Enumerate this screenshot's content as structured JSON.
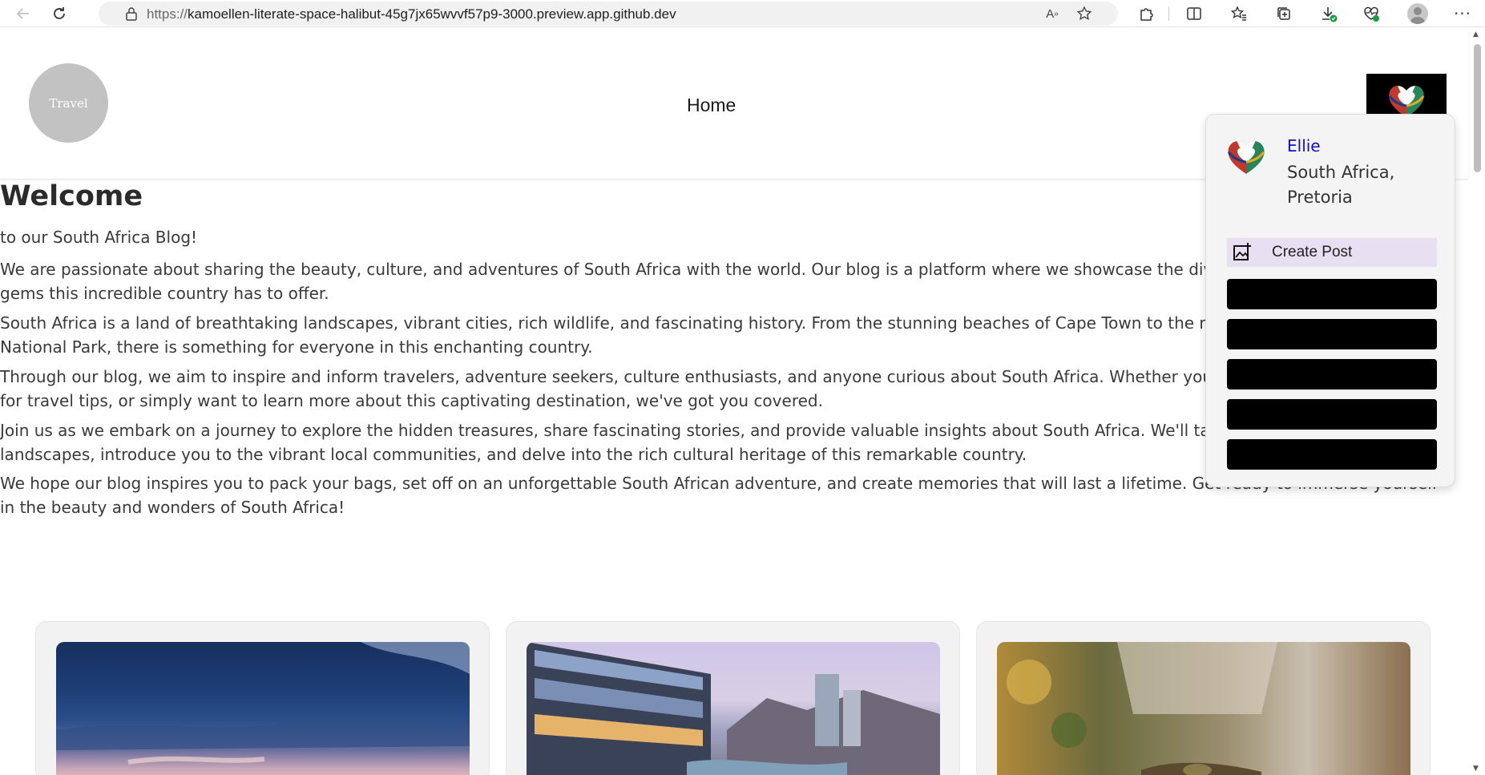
{
  "browser": {
    "url_scheme": "https://",
    "url_host": "kamoellen-literate-space-halibut-45g7jx65wvvf57p9-3000.preview.app.github.dev",
    "icons": [
      "back-icon",
      "refresh-icon",
      "lock-icon",
      "read-aloud-icon",
      "favorite-icon",
      "extensions-icon",
      "split-screen-icon",
      "favorites-icon",
      "collections-icon",
      "downloads-icon",
      "performance-icon",
      "profile-icon",
      "more-icon"
    ]
  },
  "header": {
    "logo_text": "Travel",
    "nav_home": "Home"
  },
  "main": {
    "title": "Welcome",
    "paragraphs": [
      "to our South Africa Blog!",
      "We are passionate about sharing the beauty, culture, and adventures of South Africa with the world. Our blog is a platform where we showcase the diverse experiences and hidden gems this incredible country has to offer.",
      "South Africa is a land of breathtaking landscapes, vibrant cities, rich wildlife, and fascinating history. From the stunning beaches of Cape Town to the majestic wildlife of Kruger National Park, there is something for everyone in this enchanting country.",
      "Through our blog, we aim to inspire and inform travelers, adventure seekers, culture enthusiasts, and anyone curious about South Africa. Whether you are planning a trip, looking for travel tips, or simply want to learn more about this captivating destination, we've got you covered.",
      "Join us as we embark on a journey to explore the hidden treasures, share fascinating stories, and provide valuable insights about South Africa. We'll take you through the diverse landscapes, introduce you to the vibrant local communities, and delve into the rich cultural heritage of this remarkable country.",
      "We hope our blog inspires you to pack your bags, set off on an unforgettable South African adventure, and create memories that will last a lifetime. Get ready to immerse yourself in the beauty and wonders of South Africa!"
    ]
  },
  "profile_menu": {
    "name": "Ellie",
    "location": "South Africa, Pretoria",
    "create_post": "Create Post"
  },
  "cards": [
    {
      "image": "ocean-sunset-image"
    },
    {
      "image": "waterfront-buildings-image"
    },
    {
      "image": "crocodile-image"
    }
  ],
  "colors": {
    "link_name": "#1010c8",
    "create_post_bg": "#e6e0f2",
    "logo_bg": "#c2c2c2"
  }
}
